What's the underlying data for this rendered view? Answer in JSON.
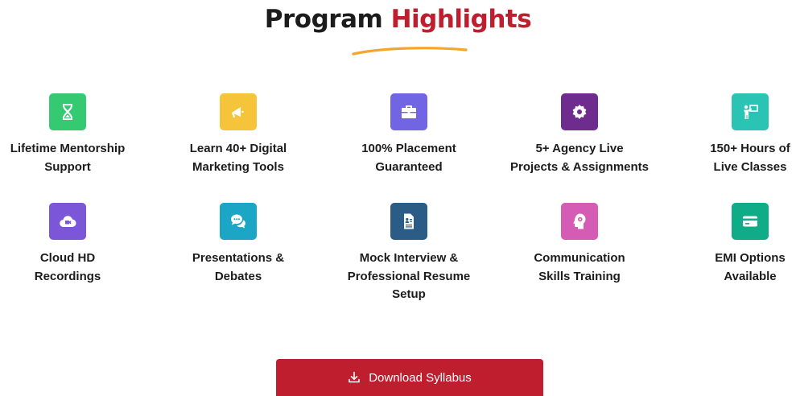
{
  "heading": {
    "part1": "Program",
    "part2": "Highlights"
  },
  "colors": {
    "accent": "#be1e2d",
    "underline": "#f4a62a",
    "text": "#1c1c1c"
  },
  "features": [
    {
      "label": "Lifetime Mentorship\nSupport",
      "icon": "hourglass-icon",
      "color": "#35c972"
    },
    {
      "label": "Learn 40+ Digital\nMarketing Tools",
      "icon": "megaphone-icon",
      "color": "#f5c43b"
    },
    {
      "label": "100% Placement\nGuaranteed",
      "icon": "briefcase-icon",
      "color": "#7165e3"
    },
    {
      "label": "5+ Agency Live\nProjects & Assignments",
      "icon": "gear-icon",
      "color": "#6f2c8f"
    },
    {
      "label": "150+ Hours of\nLive Classes",
      "icon": "presenter-icon",
      "color": "#2bc3b4"
    },
    {
      "label": "Cloud HD\nRecordings",
      "icon": "cloud-video-icon",
      "color": "#7b57d8"
    },
    {
      "label": "Presentations &\nDebates",
      "icon": "chat-bubbles-icon",
      "color": "#1aa6c4"
    },
    {
      "label": "Mock Interview &\nProfessional Resume\nSetup",
      "icon": "resume-icon",
      "color": "#2b5c86"
    },
    {
      "label": "Communication\nSkills Training",
      "icon": "head-brain-icon",
      "color": "#d45cb4"
    },
    {
      "label": "EMI Options\nAvailable",
      "icon": "credit-card-icon",
      "color": "#10ab87"
    }
  ],
  "download_button": {
    "label": "Download Syllabus",
    "icon": "download-icon"
  }
}
